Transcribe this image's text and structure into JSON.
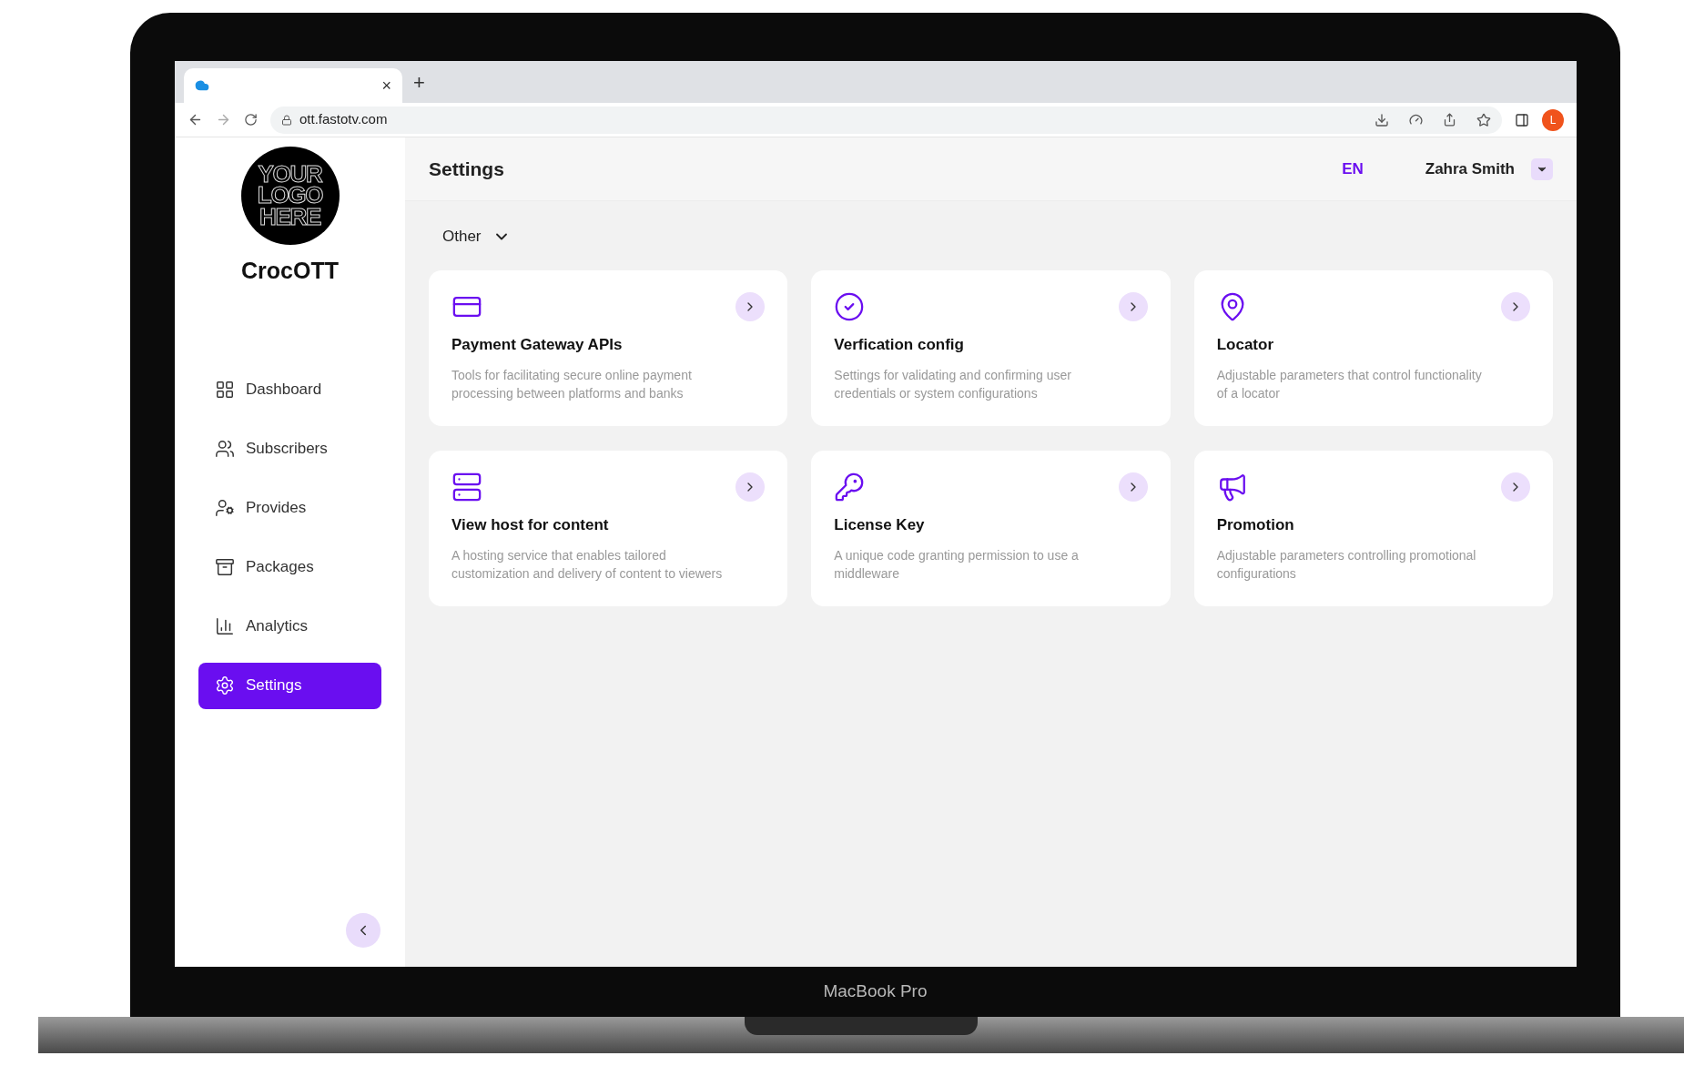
{
  "device": {
    "label": "MacBook Pro"
  },
  "browser": {
    "url": "ott.fastotv.com",
    "tab_close": "×",
    "new_tab": "+",
    "profile_initial": "L"
  },
  "sidebar": {
    "logo_lines": [
      "YOUR",
      "LOGO",
      "HERE"
    ],
    "brand": "CrocOTT",
    "items": [
      {
        "label": "Dashboard",
        "kind": "grid",
        "selected": false
      },
      {
        "label": "Subscribers",
        "kind": "users",
        "selected": false
      },
      {
        "label": "Provides",
        "kind": "usergear",
        "selected": false
      },
      {
        "label": "Packages",
        "kind": "box",
        "selected": false
      },
      {
        "label": "Analytics",
        "kind": "bars",
        "selected": false
      },
      {
        "label": "Settings",
        "kind": "gear",
        "selected": true
      }
    ]
  },
  "header": {
    "title": "Settings",
    "language": "EN",
    "user": "Zahra Smith"
  },
  "filter": {
    "label": "Other"
  },
  "cards": [
    {
      "kind": "card",
      "title": "Payment Gateway APIs",
      "description": "Tools for facilitating secure online payment processing between platforms and banks"
    },
    {
      "kind": "check",
      "title": "Verfication config",
      "description": "Settings for validating and confirming user credentials or system configurations"
    },
    {
      "kind": "pin",
      "title": "Locator",
      "description": "Adjustable parameters that control functionality of a locator"
    },
    {
      "kind": "server",
      "title": "View host for content",
      "description": "A hosting service that enables tailored customization and delivery of content to viewers"
    },
    {
      "kind": "key",
      "title": "License Key",
      "description": "A unique code granting permission to use a middleware"
    },
    {
      "kind": "megaphone",
      "title": "Promotion",
      "description": "Adjustable parameters controlling promotional configurations"
    }
  ]
}
